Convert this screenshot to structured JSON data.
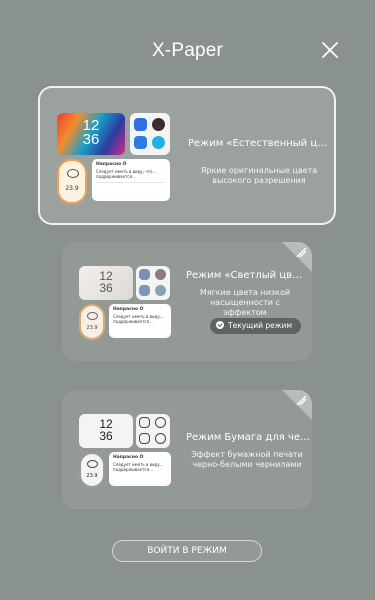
{
  "header": {
    "title": "X-Paper",
    "close_icon": "close-icon"
  },
  "modes": [
    {
      "title": "Режим «Естественный цв…",
      "description": "Яркие оригинальные цвета высокого разрешения",
      "preview": {
        "clock_top": "12",
        "clock_bottom": "36",
        "temp": "23.9",
        "note_title": "Напрасно О",
        "note_text_1": "Следует иметь в виду, что...",
        "note_text_2": "поддерживается..."
      },
      "active": true
    },
    {
      "title": "Режим «Светлый цвет»",
      "description": "Мягкие цвета низкой насыщенности с эффектом",
      "badge": "Текущий режим",
      "preview": {
        "clock_top": "12",
        "clock_bottom": "36",
        "temp": "23.9",
        "note_title": "Напрасно О",
        "note_text_1": "Следует иметь в виду...",
        "note_text_2": "поддерживается..."
      },
      "active": false
    },
    {
      "title": "Режим Бумага для чернил",
      "description": "Эффект бумажной печати черно-белыми чернилами",
      "preview": {
        "clock_top": "12",
        "clock_bottom": "36",
        "temp": "23.9",
        "note_title": "Напрасно О",
        "note_text_1": "Следует иметь в виду...",
        "note_text_2": "поддерживается..."
      },
      "active": false
    }
  ],
  "footer": {
    "button_label": "ВОЙТИ В РЕЖИМ"
  },
  "colors": {
    "background": "#8a928e",
    "accent_orange": "#f2a24a",
    "icon_blue": "#2f6fe0"
  }
}
